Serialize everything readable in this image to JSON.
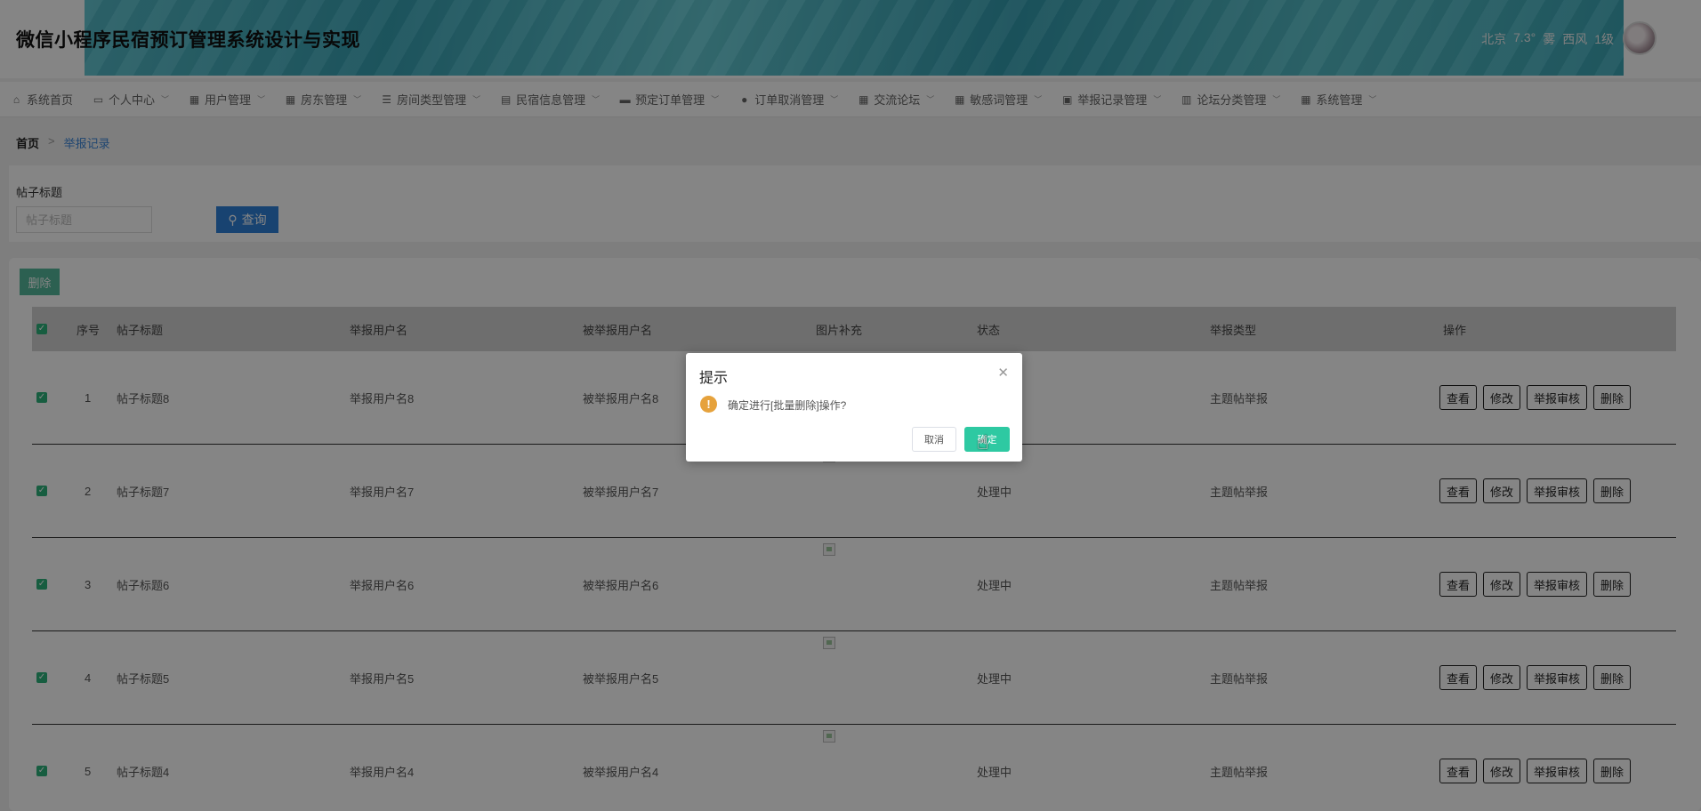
{
  "header": {
    "title": "微信小程序民宿预订管理系统设计与实现",
    "weather": {
      "city": "北京",
      "temp": "7.3°",
      "condition": "雾",
      "wind": "西风",
      "level": "1级"
    }
  },
  "nav": {
    "items": [
      {
        "label": "系统首页",
        "icon": "home-icon"
      },
      {
        "label": "个人中心",
        "icon": "window-icon"
      },
      {
        "label": "用户管理",
        "icon": "grid-icon"
      },
      {
        "label": "房东管理",
        "icon": "grid-icon"
      },
      {
        "label": "房间类型管理",
        "icon": "list-icon"
      },
      {
        "label": "民宿信息管理",
        "icon": "doc-icon"
      },
      {
        "label": "预定订单管理",
        "icon": "monitor-icon"
      },
      {
        "label": "订单取消管理",
        "icon": "user-icon"
      },
      {
        "label": "交流论坛",
        "icon": "grid-icon"
      },
      {
        "label": "敏感词管理",
        "icon": "grid-icon"
      },
      {
        "label": "举报记录管理",
        "icon": "clipboard-icon"
      },
      {
        "label": "论坛分类管理",
        "icon": "chart-icon"
      },
      {
        "label": "系统管理",
        "icon": "grid-icon"
      }
    ]
  },
  "breadcrumb": {
    "home": "首页",
    "separator": ">",
    "current": "举报记录"
  },
  "search": {
    "label": "帖子标题",
    "placeholder": "帖子标题",
    "value": "",
    "button_label": "查询"
  },
  "toolbar": {
    "batch_delete_label": "删除"
  },
  "table": {
    "columns": [
      "序号",
      "帖子标题",
      "举报用户名",
      "被举报用户名",
      "图片补充",
      "状态",
      "举报类型",
      "操作"
    ],
    "rows": [
      {
        "index": "1",
        "title": "帖子标题8",
        "reporter": "举报用户名8",
        "reported": "被举报用户名8",
        "status": "",
        "type": "主题帖举报"
      },
      {
        "index": "2",
        "title": "帖子标题7",
        "reporter": "举报用户名7",
        "reported": "被举报用户名7",
        "status": "处理中",
        "type": "主题帖举报"
      },
      {
        "index": "3",
        "title": "帖子标题6",
        "reporter": "举报用户名6",
        "reported": "被举报用户名6",
        "status": "处理中",
        "type": "主题帖举报"
      },
      {
        "index": "4",
        "title": "帖子标题5",
        "reporter": "举报用户名5",
        "reported": "被举报用户名5",
        "status": "处理中",
        "type": "主题帖举报"
      },
      {
        "index": "5",
        "title": "帖子标题4",
        "reporter": "举报用户名4",
        "reported": "被举报用户名4",
        "status": "处理中",
        "type": "主题帖举报"
      }
    ],
    "row_actions": [
      "查看",
      "修改",
      "举报审核",
      "删除"
    ]
  },
  "dialog": {
    "title": "提示",
    "message": "确定进行[批量删除]操作?",
    "cancel_label": "取消",
    "confirm_label": "确定"
  },
  "colors": {
    "primary": "#2f80d8",
    "success": "#2ec9a2",
    "warning": "#e6a23c",
    "checkbox": "#2db37c"
  }
}
